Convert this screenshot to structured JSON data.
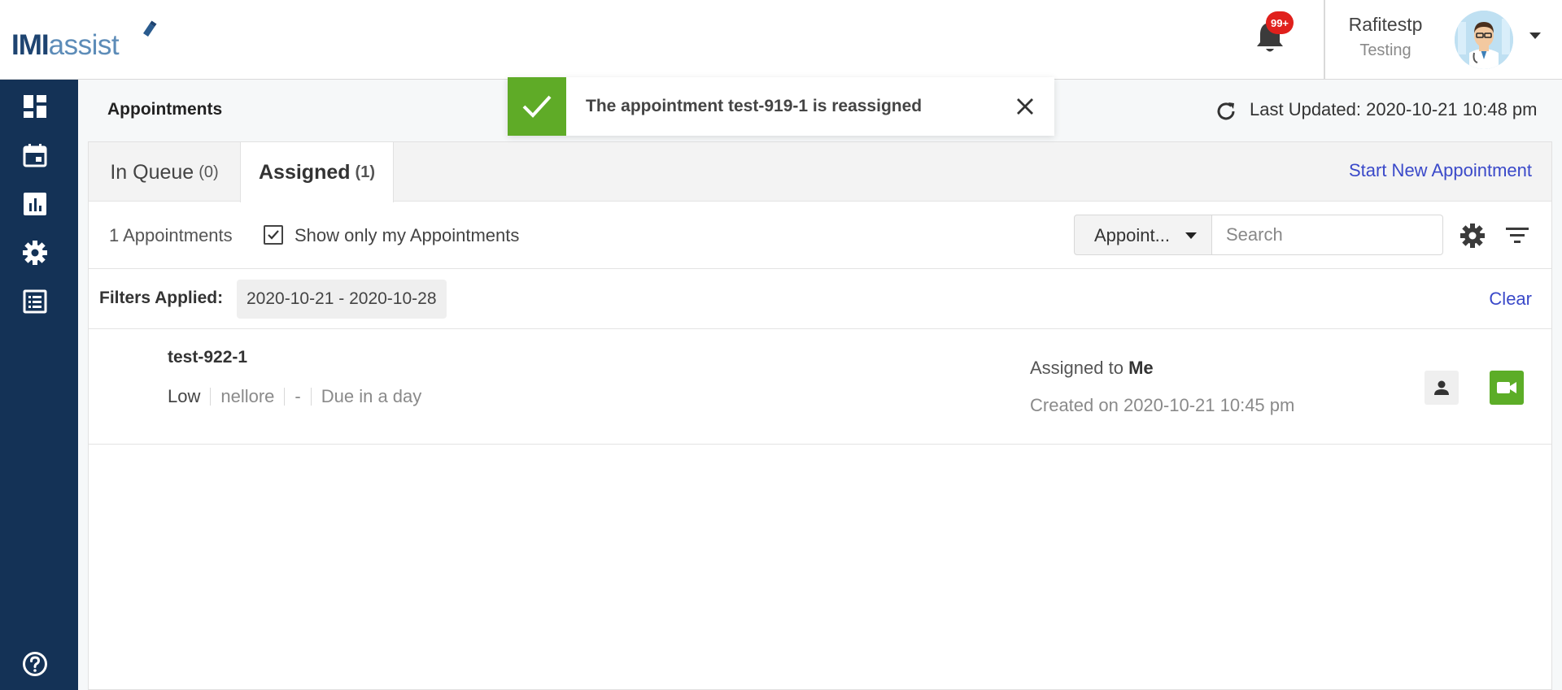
{
  "app": {
    "logo_bold": "IMI",
    "logo_light": "assist"
  },
  "header": {
    "notification_badge": "99+",
    "user_name": "Rafitestp",
    "user_role": "Testing",
    "icons": {
      "bell": "bell-icon",
      "avatar": "doctor-avatar",
      "caret": "caret-down-icon"
    }
  },
  "sidebar": {
    "items": [
      {
        "icon": "dashboard-icon"
      },
      {
        "icon": "calendar-icon"
      },
      {
        "icon": "bar-chart-icon"
      },
      {
        "icon": "gear-icon"
      },
      {
        "icon": "list-table-icon"
      }
    ],
    "help_icon": "help-circle-icon"
  },
  "page": {
    "title": "Appointments",
    "last_updated": "Last Updated: 2020-10-21 10:48 pm"
  },
  "tabs": [
    {
      "label": "In Queue",
      "count": "(0)",
      "active": false
    },
    {
      "label": "Assigned",
      "count": "(1)",
      "active": true
    }
  ],
  "start_new_label": "Start New Appointment",
  "toolbar": {
    "appointments_count": "1 Appointments",
    "only_mine_label": "Show only my Appointments",
    "only_mine_checked": true,
    "select_value": "Appoint...",
    "search_placeholder": "Search"
  },
  "filters": {
    "label": "Filters Applied:",
    "chip": "2020-10-21 - 2020-10-28",
    "clear_label": "Clear"
  },
  "appointments": [
    {
      "title": "test-922-1",
      "priority": "Low",
      "location": "nellore",
      "extra": "-",
      "due": "Due in a day",
      "assigned_prefix": "Assigned to",
      "assigned_to": "Me",
      "created": "Created on 2020-10-21 10:45 pm"
    }
  ],
  "toast": {
    "message": "The appointment test-919-1 is reassigned"
  },
  "colors": {
    "sidebar": "#143256",
    "accent_green": "#5fab27",
    "link_blue": "#3a49c9",
    "badge_red": "#e0201c"
  }
}
